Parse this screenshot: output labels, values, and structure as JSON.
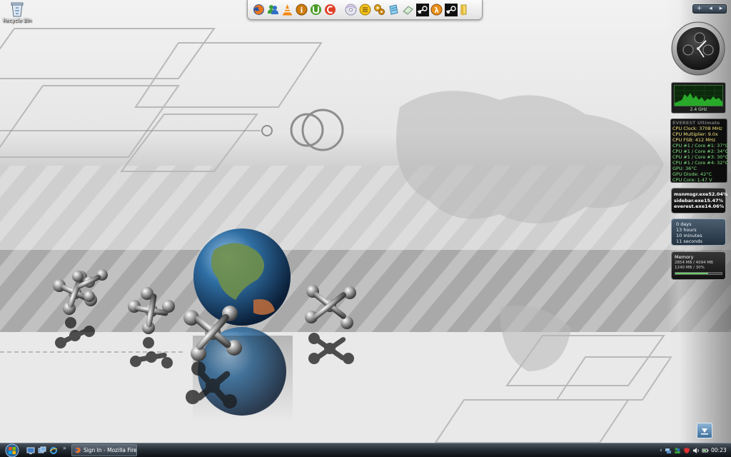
{
  "desktop": {
    "recycle_bin_label": "Recycle Bin"
  },
  "dock": {
    "items": [
      "firefox-icon",
      "messenger-icon",
      "vlc-icon",
      "info-icon",
      "utorrent-icon",
      "ccleaner-icon",
      "dvd-icon",
      "menu-icon",
      "gears-icon",
      "notepad-icon",
      "eraser-icon",
      "steam-icon",
      "half-life-icon",
      "steam-icon-2",
      "folder-icon"
    ]
  },
  "sidebar": {
    "controls": {
      "add": "+",
      "prev": "◂",
      "next": "▸"
    },
    "cpu_graph": {
      "frequency": "2.4 GHz"
    },
    "everest": {
      "title": "EVEREST Ultimate",
      "lines": [
        {
          "text": "CPU Clock: 3708 MHz",
          "color": "#f3e27a"
        },
        {
          "text": "CPU Multiplier: 9.0x",
          "color": "#f3e27a"
        },
        {
          "text": "CPU FSB: 412 MHz",
          "color": "#f3e27a"
        },
        {
          "text": "CPU #1 / Core #1: 37°C",
          "color": "#7de07d"
        },
        {
          "text": "CPU #1 / Core #2: 34°C",
          "color": "#7de07d"
        },
        {
          "text": "CPU #1 / Core #3: 30°C",
          "color": "#7de07d"
        },
        {
          "text": "CPU #1 / Core #4: 32°C",
          "color": "#7de07d"
        },
        {
          "text": "GPU: 36°C",
          "color": "#7de07d"
        },
        {
          "text": "GPU Diode: 42°C",
          "color": "#7de07d"
        },
        {
          "text": "CPU Core: 1.47 V",
          "color": "#7de07d"
        }
      ]
    },
    "top_processes": [
      {
        "name": "msnmsgr.exe",
        "percent": "52.04%"
      },
      {
        "name": "sidebar.exe",
        "percent": "15.47%"
      },
      {
        "name": "everest.exe",
        "percent": "14.06%"
      }
    ],
    "uptime": {
      "days": "0 days",
      "hours": "13 hours",
      "minutes": "10 minutes",
      "seconds": "11 seconds"
    },
    "memory": {
      "title": "Memory",
      "line1": "2854 MB / 4094 MB",
      "line2": "1240 MB / 30%",
      "usage_fraction": 0.7
    }
  },
  "taskbar": {
    "quick_launch": [
      "show-desktop-icon",
      "switch-windows-icon",
      "internet-explorer-icon"
    ],
    "more": "»",
    "task_label": "Sign In - Mozilla Fire...",
    "tray_chevron": "‹",
    "tray_icons": [
      "network-icon",
      "messenger-tray-icon",
      "shield-tray-icon",
      "speaker-icon",
      "power-icon"
    ],
    "clock": "00:23"
  },
  "colors": {
    "taskbar": "#1c2228",
    "everest_yellow": "#f3e27a",
    "everest_green": "#7de07d",
    "memory_bar": "#2fa52f"
  }
}
